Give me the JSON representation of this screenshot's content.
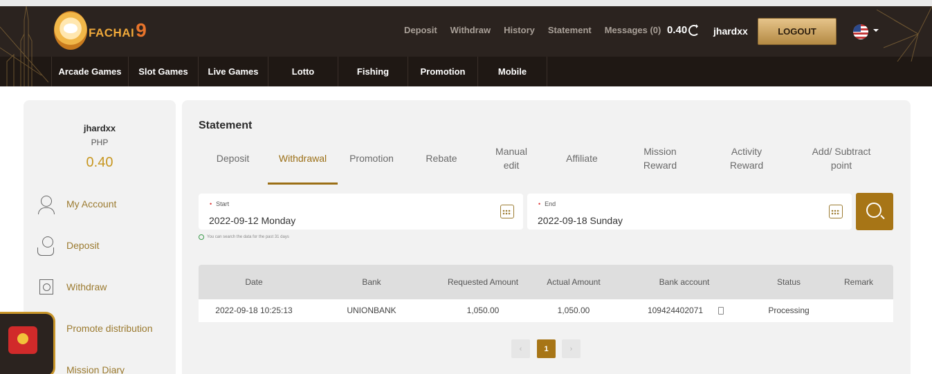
{
  "header": {
    "brand_name": "FACHAI",
    "brand_number": "9",
    "links": [
      "Deposit",
      "Withdraw",
      "History",
      "Statement",
      "Messages (0)"
    ],
    "balance": "0.40",
    "username": "jhardxx",
    "logout_label": "LOGOUT"
  },
  "nav": [
    "Arcade Games",
    "Slot Games",
    "Live Games",
    "Lotto",
    "Fishing",
    "Promotion",
    "Mobile"
  ],
  "sidebar": {
    "username": "jhardxx",
    "currency": "PHP",
    "balance": "0.40",
    "items": [
      "My Account",
      "Deposit",
      "Withdraw",
      "Promote distribution",
      "Mission Diary"
    ]
  },
  "main": {
    "title": "Statement",
    "tabs": [
      {
        "label": "Deposit"
      },
      {
        "label": "Withdrawal"
      },
      {
        "label": "Promotion"
      },
      {
        "label": "Rebate"
      },
      {
        "label": "Manual edit"
      },
      {
        "label": "Affiliate"
      },
      {
        "label": "Mission Reward"
      },
      {
        "label": "Activity Reward"
      },
      {
        "label": "Add/ Subtract point"
      }
    ],
    "active_tab": "Withdrawal",
    "start_label": "Start",
    "start_value": "2022-09-12 Monday",
    "end_label": "End",
    "end_value": "2022-09-18 Sunday",
    "hint": "You can search the data for the past 31 days",
    "columns": [
      "Date",
      "Bank",
      "Requested Amount",
      "Actual Amount",
      "Bank account",
      "Status",
      "Remark"
    ],
    "rows": [
      [
        "2022-09-18 10:25:13",
        "UNIONBANK",
        "1,050.00",
        "1,050.00",
        "109424402071",
        "Processing",
        ""
      ]
    ],
    "pagination": {
      "prev": "‹",
      "current": "1",
      "next": "›"
    }
  },
  "colors": {
    "accent": "#a77516",
    "header_bg": "#2b231f",
    "nav_bg": "#1f1814"
  }
}
